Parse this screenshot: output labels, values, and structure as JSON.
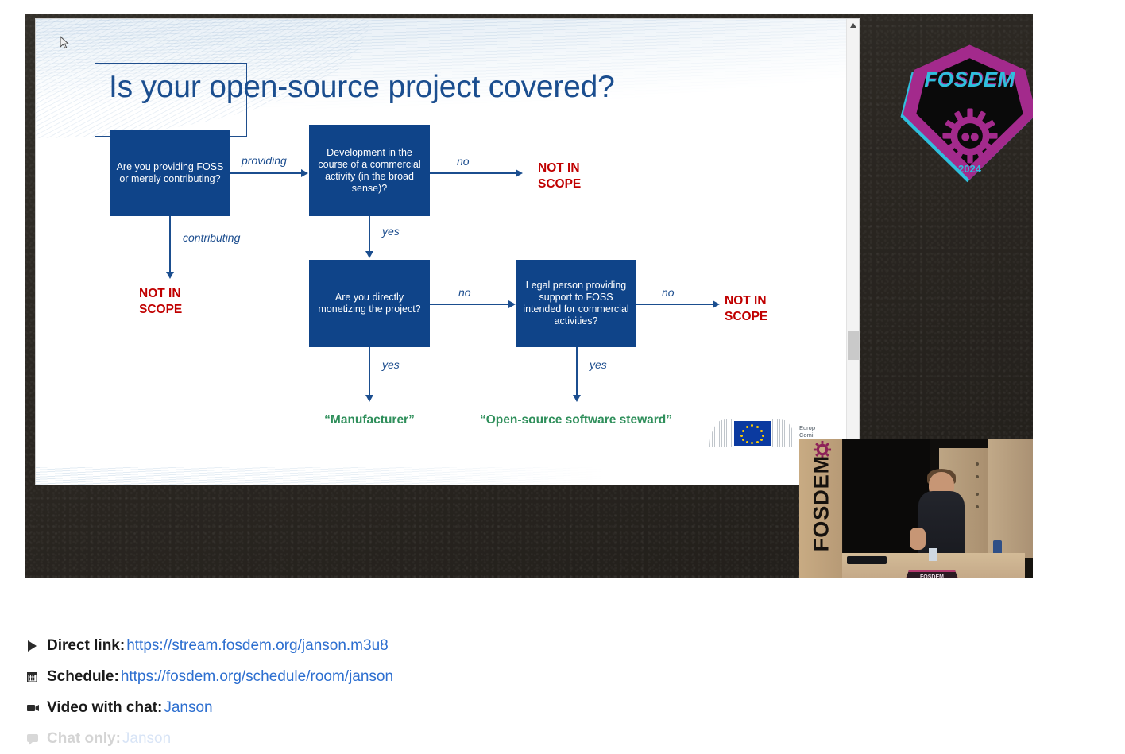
{
  "slide": {
    "title": "Is your open-source project covered?",
    "flow": {
      "boxes": [
        {
          "id": "b1",
          "text": "Are you providing FOSS or merely contributing?"
        },
        {
          "id": "b2",
          "text": "Development in the course of a commercial activity (in the broad sense)?"
        },
        {
          "id": "b3",
          "text": "Are you directly monetizing the project?"
        },
        {
          "id": "b4",
          "text": "Legal person providing support to FOSS intended for commercial activities?"
        }
      ],
      "edge_labels": {
        "providing": "providing",
        "contributing": "contributing",
        "no1": "no",
        "yes1": "yes",
        "no2": "no",
        "yes2": "yes",
        "no3": "no",
        "yes3": "yes"
      },
      "outcomes": {
        "not_in_scope_1": "NOT IN SCOPE",
        "not_in_scope_2": "NOT IN SCOPE",
        "not_in_scope_3": "NOT IN SCOPE",
        "manufacturer": "“Manufacturer”",
        "steward": "“Open-source software steward”"
      },
      "colors": {
        "box": "#0f4489",
        "arrow": "#1b4e8f",
        "not_in_scope": "#c00000",
        "outcome_green": "#2f8f5b",
        "title": "#1b4e8f"
      }
    },
    "eu_logo": {
      "line1": "Europ",
      "line2": "Comi"
    },
    "scrollbar": {
      "up_arrow": "▲"
    }
  },
  "badge": {
    "name": "FOSDEM",
    "year": "2024",
    "colors": {
      "magenta": "#a32a8c",
      "cyan": "#2fbfdd"
    }
  },
  "webcam": {
    "banner_text": "FOSDEM",
    "table_logo_text": "FOSDEM"
  },
  "links": [
    {
      "icon": "play-icon",
      "glyph": "▶",
      "label": "Direct link",
      "separator": ":",
      "url": "https://stream.fosdem.org/janson.m3u8"
    },
    {
      "icon": "calendar-icon",
      "glyph": "Ὄ5",
      "label": "Schedule",
      "separator": ":",
      "url": "https://fosdem.org/schedule/room/janson"
    },
    {
      "icon": "video-icon",
      "glyph": "▰",
      "label": "Video with chat",
      "separator": ":",
      "url": "Janson"
    },
    {
      "icon": "chat-icon",
      "glyph": "▰",
      "label": "Chat only",
      "separator": ":",
      "url": "Janson"
    }
  ]
}
